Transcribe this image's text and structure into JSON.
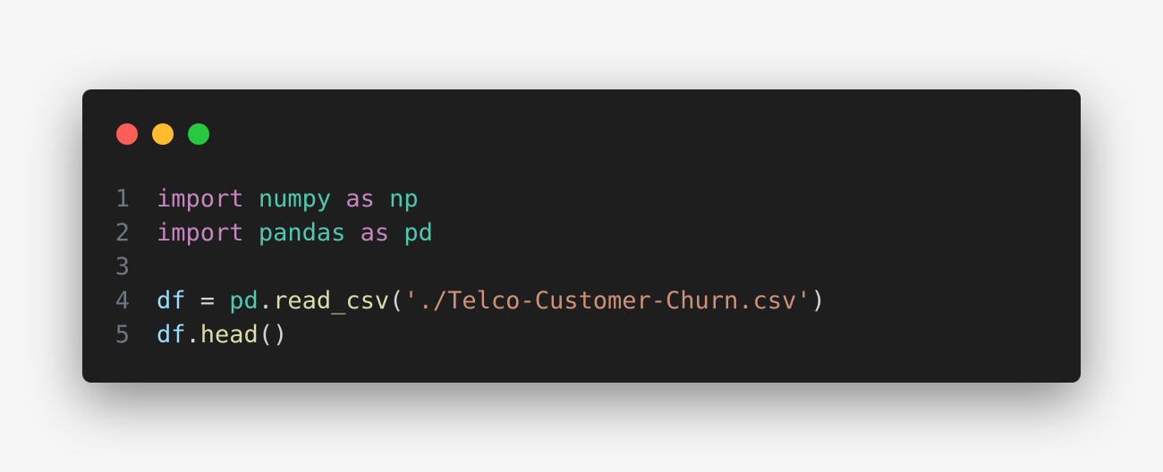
{
  "window": {
    "controls": [
      {
        "name": "close",
        "color": "#ff5f56"
      },
      {
        "name": "minimize",
        "color": "#ffbd2e"
      },
      {
        "name": "maximize",
        "color": "#27c93f"
      }
    ]
  },
  "code": {
    "lines": [
      {
        "number": "1",
        "tokens": [
          {
            "t": "import",
            "c": "kw"
          },
          {
            "t": " ",
            "c": "pl"
          },
          {
            "t": "numpy",
            "c": "mod"
          },
          {
            "t": " ",
            "c": "pl"
          },
          {
            "t": "as",
            "c": "kw"
          },
          {
            "t": " ",
            "c": "pl"
          },
          {
            "t": "np",
            "c": "mod"
          }
        ]
      },
      {
        "number": "2",
        "tokens": [
          {
            "t": "import",
            "c": "kw"
          },
          {
            "t": " ",
            "c": "pl"
          },
          {
            "t": "pandas",
            "c": "mod"
          },
          {
            "t": " ",
            "c": "pl"
          },
          {
            "t": "as",
            "c": "kw"
          },
          {
            "t": " ",
            "c": "pl"
          },
          {
            "t": "pd",
            "c": "mod"
          }
        ]
      },
      {
        "number": "3",
        "tokens": []
      },
      {
        "number": "4",
        "tokens": [
          {
            "t": "df",
            "c": "var"
          },
          {
            "t": " = ",
            "c": "pl"
          },
          {
            "t": "pd",
            "c": "mod"
          },
          {
            "t": ".",
            "c": "pl"
          },
          {
            "t": "read_csv",
            "c": "fn"
          },
          {
            "t": "(",
            "c": "pl"
          },
          {
            "t": "'./Telco-Customer-Churn.csv'",
            "c": "str"
          },
          {
            "t": ")",
            "c": "pl"
          }
        ]
      },
      {
        "number": "5",
        "tokens": [
          {
            "t": "df",
            "c": "var"
          },
          {
            "t": ".",
            "c": "pl"
          },
          {
            "t": "head",
            "c": "fn"
          },
          {
            "t": "()",
            "c": "pl"
          }
        ]
      }
    ]
  }
}
